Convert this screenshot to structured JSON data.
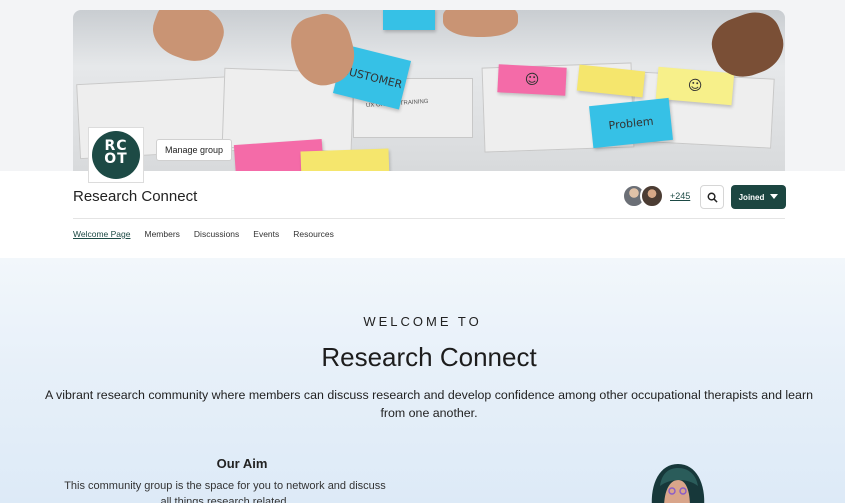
{
  "group": {
    "logo_text": "RC\nOT",
    "manage_label": "Manage group",
    "title": "Research Connect",
    "member_count": "+245",
    "joined_label": "Joined"
  },
  "banner": {
    "sticky_customer": "CUSTOMER",
    "sticky_problem": "Problem",
    "paper_label": "UX ONLINE TRAINING",
    "sticky_colors": [
      "#36c1e6",
      "#f46ba8",
      "#f5e66d",
      "#f7f08a"
    ]
  },
  "nav": {
    "items": [
      "Welcome Page",
      "Members",
      "Discussions",
      "Events",
      "Resources"
    ]
  },
  "welcome": {
    "eyebrow": "WELCOME TO",
    "title": "Research Connect",
    "description": "A vibrant research community where members can discuss research and develop confidence among other occupational therapists and learn from one another.",
    "aim_title": "Our Aim",
    "aim_text": "This community group is the space for you to network and discuss all things research related."
  },
  "colors": {
    "brand": "#1c4641",
    "welcome_bg": "#e7f0f9"
  }
}
